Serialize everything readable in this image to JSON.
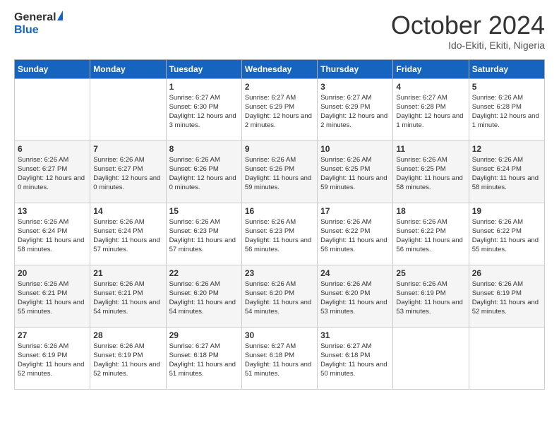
{
  "header": {
    "logo_general": "General",
    "logo_blue": "Blue",
    "month_title": "October 2024",
    "subtitle": "Ido-Ekiti, Ekiti, Nigeria"
  },
  "weekdays": [
    "Sunday",
    "Monday",
    "Tuesday",
    "Wednesday",
    "Thursday",
    "Friday",
    "Saturday"
  ],
  "weeks": [
    [
      {
        "day": "",
        "info": ""
      },
      {
        "day": "",
        "info": ""
      },
      {
        "day": "1",
        "info": "Sunrise: 6:27 AM\nSunset: 6:30 PM\nDaylight: 12 hours and 3 minutes."
      },
      {
        "day": "2",
        "info": "Sunrise: 6:27 AM\nSunset: 6:29 PM\nDaylight: 12 hours and 2 minutes."
      },
      {
        "day": "3",
        "info": "Sunrise: 6:27 AM\nSunset: 6:29 PM\nDaylight: 12 hours and 2 minutes."
      },
      {
        "day": "4",
        "info": "Sunrise: 6:27 AM\nSunset: 6:28 PM\nDaylight: 12 hours and 1 minute."
      },
      {
        "day": "5",
        "info": "Sunrise: 6:26 AM\nSunset: 6:28 PM\nDaylight: 12 hours and 1 minute."
      }
    ],
    [
      {
        "day": "6",
        "info": "Sunrise: 6:26 AM\nSunset: 6:27 PM\nDaylight: 12 hours and 0 minutes."
      },
      {
        "day": "7",
        "info": "Sunrise: 6:26 AM\nSunset: 6:27 PM\nDaylight: 12 hours and 0 minutes."
      },
      {
        "day": "8",
        "info": "Sunrise: 6:26 AM\nSunset: 6:26 PM\nDaylight: 12 hours and 0 minutes."
      },
      {
        "day": "9",
        "info": "Sunrise: 6:26 AM\nSunset: 6:26 PM\nDaylight: 11 hours and 59 minutes."
      },
      {
        "day": "10",
        "info": "Sunrise: 6:26 AM\nSunset: 6:25 PM\nDaylight: 11 hours and 59 minutes."
      },
      {
        "day": "11",
        "info": "Sunrise: 6:26 AM\nSunset: 6:25 PM\nDaylight: 11 hours and 58 minutes."
      },
      {
        "day": "12",
        "info": "Sunrise: 6:26 AM\nSunset: 6:24 PM\nDaylight: 11 hours and 58 minutes."
      }
    ],
    [
      {
        "day": "13",
        "info": "Sunrise: 6:26 AM\nSunset: 6:24 PM\nDaylight: 11 hours and 58 minutes."
      },
      {
        "day": "14",
        "info": "Sunrise: 6:26 AM\nSunset: 6:24 PM\nDaylight: 11 hours and 57 minutes."
      },
      {
        "day": "15",
        "info": "Sunrise: 6:26 AM\nSunset: 6:23 PM\nDaylight: 11 hours and 57 minutes."
      },
      {
        "day": "16",
        "info": "Sunrise: 6:26 AM\nSunset: 6:23 PM\nDaylight: 11 hours and 56 minutes."
      },
      {
        "day": "17",
        "info": "Sunrise: 6:26 AM\nSunset: 6:22 PM\nDaylight: 11 hours and 56 minutes."
      },
      {
        "day": "18",
        "info": "Sunrise: 6:26 AM\nSunset: 6:22 PM\nDaylight: 11 hours and 56 minutes."
      },
      {
        "day": "19",
        "info": "Sunrise: 6:26 AM\nSunset: 6:22 PM\nDaylight: 11 hours and 55 minutes."
      }
    ],
    [
      {
        "day": "20",
        "info": "Sunrise: 6:26 AM\nSunset: 6:21 PM\nDaylight: 11 hours and 55 minutes."
      },
      {
        "day": "21",
        "info": "Sunrise: 6:26 AM\nSunset: 6:21 PM\nDaylight: 11 hours and 54 minutes."
      },
      {
        "day": "22",
        "info": "Sunrise: 6:26 AM\nSunset: 6:20 PM\nDaylight: 11 hours and 54 minutes."
      },
      {
        "day": "23",
        "info": "Sunrise: 6:26 AM\nSunset: 6:20 PM\nDaylight: 11 hours and 54 minutes."
      },
      {
        "day": "24",
        "info": "Sunrise: 6:26 AM\nSunset: 6:20 PM\nDaylight: 11 hours and 53 minutes."
      },
      {
        "day": "25",
        "info": "Sunrise: 6:26 AM\nSunset: 6:19 PM\nDaylight: 11 hours and 53 minutes."
      },
      {
        "day": "26",
        "info": "Sunrise: 6:26 AM\nSunset: 6:19 PM\nDaylight: 11 hours and 52 minutes."
      }
    ],
    [
      {
        "day": "27",
        "info": "Sunrise: 6:26 AM\nSunset: 6:19 PM\nDaylight: 11 hours and 52 minutes."
      },
      {
        "day": "28",
        "info": "Sunrise: 6:26 AM\nSunset: 6:19 PM\nDaylight: 11 hours and 52 minutes."
      },
      {
        "day": "29",
        "info": "Sunrise: 6:27 AM\nSunset: 6:18 PM\nDaylight: 11 hours and 51 minutes."
      },
      {
        "day": "30",
        "info": "Sunrise: 6:27 AM\nSunset: 6:18 PM\nDaylight: 11 hours and 51 minutes."
      },
      {
        "day": "31",
        "info": "Sunrise: 6:27 AM\nSunset: 6:18 PM\nDaylight: 11 hours and 50 minutes."
      },
      {
        "day": "",
        "info": ""
      },
      {
        "day": "",
        "info": ""
      }
    ]
  ]
}
